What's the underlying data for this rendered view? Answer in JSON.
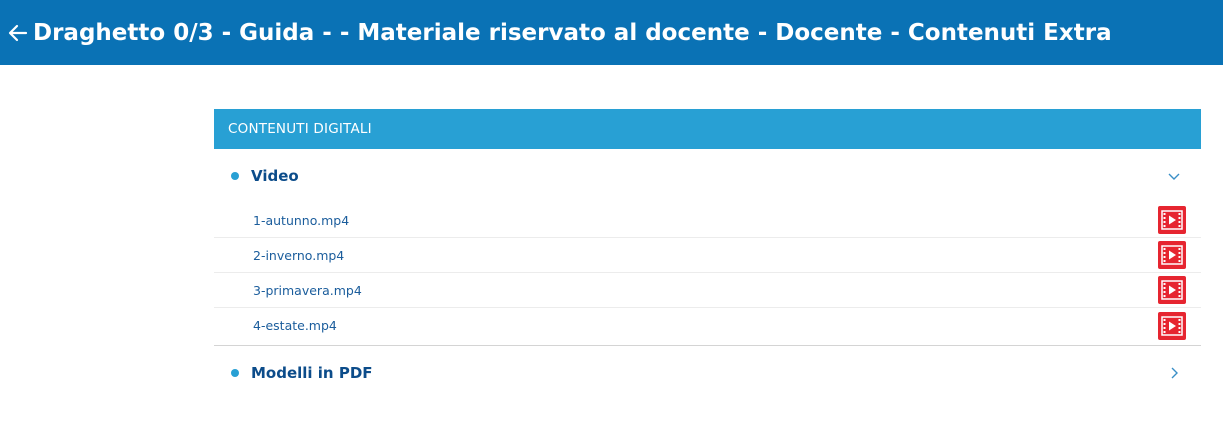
{
  "header": {
    "title": "Draghetto 0/3 - Guida - - Materiale riservato al docente - Docente - Contenuti Extra",
    "back_icon": "arrow-left-icon",
    "color": "#0a72b5"
  },
  "panel": {
    "header_label": "CONTENUTI DIGITALI",
    "header_color": "#28a0d4",
    "sections": [
      {
        "title": "Video",
        "expanded": true,
        "files": [
          {
            "name": "1-autunno.mp4",
            "icon": "video-file-icon"
          },
          {
            "name": "2-inverno.mp4",
            "icon": "video-file-icon"
          },
          {
            "name": "3-primavera.mp4",
            "icon": "video-file-icon"
          },
          {
            "name": "4-estate.mp4",
            "icon": "video-file-icon"
          }
        ]
      },
      {
        "title": "Modelli in PDF",
        "expanded": false,
        "files": []
      }
    ]
  }
}
